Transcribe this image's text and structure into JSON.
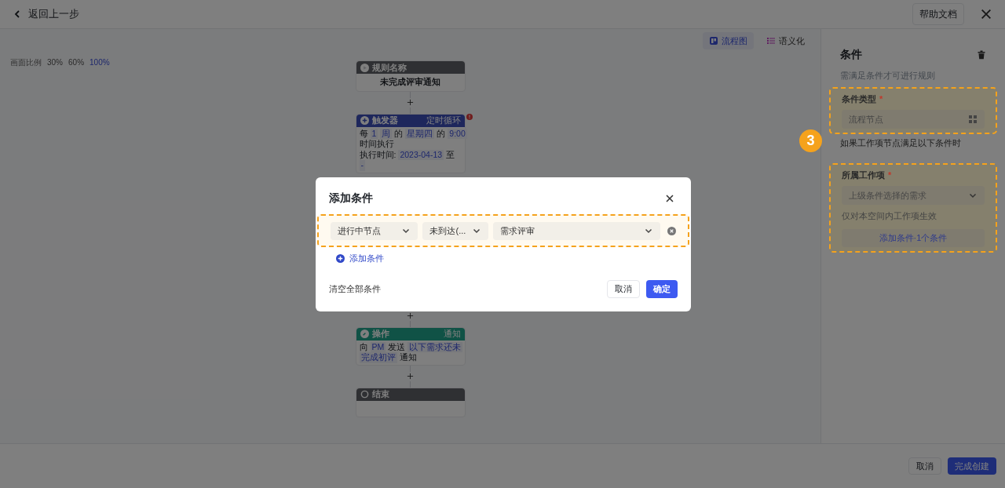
{
  "header": {
    "back_label": "返回上一步",
    "help_button": "帮助文档"
  },
  "view_tabs": [
    {
      "label": "流程图",
      "selected": true,
      "kind": "flow"
    },
    {
      "label": "语义化",
      "selected": false,
      "kind": "list"
    }
  ],
  "zoom": {
    "label": "画面比例",
    "options": [
      {
        "label": "30%",
        "selected": false
      },
      {
        "label": "60%",
        "selected": false
      },
      {
        "label": "100%",
        "selected": true
      }
    ]
  },
  "flow": {
    "nodes": [
      {
        "kind": "name",
        "title": "规则名称",
        "lines": [
          [
            {
              "text": "未完成评审通知",
              "token": false
            }
          ]
        ]
      },
      {
        "kind": "trigger",
        "title": "触发器",
        "tag": "定时循环",
        "error": true,
        "lines": [
          [
            {
              "text": "每",
              "token": false
            },
            {
              "text": "1",
              "token": true
            },
            {
              "text": "周",
              "token": true
            },
            {
              "text": "的",
              "token": false
            },
            {
              "text": "星期四",
              "token": true
            },
            {
              "text": "的",
              "token": false
            },
            {
              "text": "9:00",
              "token": true
            }
          ],
          [
            {
              "text": "时间执行",
              "token": false
            }
          ],
          [
            {
              "text": "执行时间:",
              "token": false
            },
            {
              "text": "2023-04-13",
              "token": true
            },
            {
              "text": "至",
              "token": false
            }
          ],
          [
            {
              "text": "-",
              "token": true
            }
          ]
        ]
      },
      {
        "kind": "action",
        "title": "操作",
        "tag": "通知",
        "error": false,
        "lines": [
          [
            {
              "text": "向",
              "token": false
            },
            {
              "text": "PM",
              "token": true
            },
            {
              "text": "发送",
              "token": false
            },
            {
              "text": "以下需求还未",
              "token": true
            }
          ],
          [
            {
              "text": "完成初评",
              "token": true
            },
            {
              "text": "通知",
              "token": false
            }
          ]
        ]
      },
      {
        "kind": "end",
        "title": "结束"
      }
    ]
  },
  "panel": {
    "title": "条件",
    "subtitle": "需满足条件才可进行规则",
    "badge": "3",
    "sections": [
      {
        "label": "条件类型",
        "required_mark": "*",
        "value": "流程节点",
        "kind": "grid",
        "hint": "如果工作项节点满足以下条件时"
      },
      {
        "label": "所属工作项",
        "required_mark": "*",
        "value": "上级条件选择的需求",
        "kind": "dropdown",
        "hint": "仅对本空间内工作项生效",
        "button": "添加条件·1个条件"
      }
    ]
  },
  "footer": {
    "cancel": "取消",
    "submit": "完成创建"
  },
  "modal": {
    "title": "添加条件",
    "rows": [
      {
        "fields": [
          "进行中节点",
          "未到达(...",
          "需求评审"
        ]
      }
    ],
    "add_label": "添加条件",
    "clear_label": "清空全部条件",
    "cancel": "取消",
    "confirm": "确定"
  }
}
